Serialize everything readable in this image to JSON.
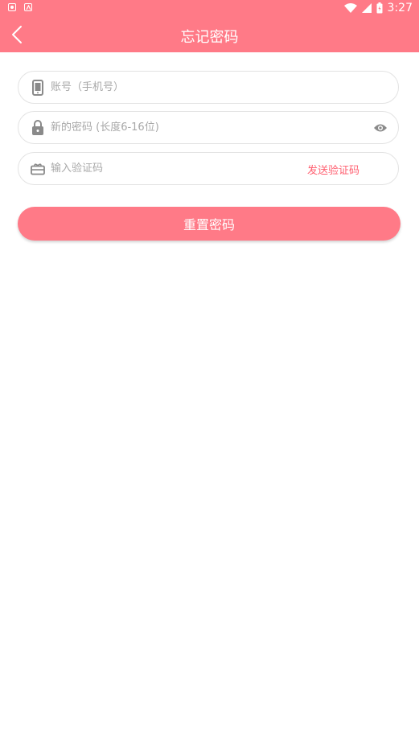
{
  "status_bar": {
    "time": "3:27",
    "left_icons": [
      "shield-icon",
      "a-icon"
    ],
    "right_icons": [
      "wifi-icon",
      "signal-icon",
      "battery-icon"
    ]
  },
  "app_bar": {
    "title": "忘记密码",
    "back_icon": "chevron-left-icon"
  },
  "form": {
    "account": {
      "value": "",
      "placeholder": "账号（手机号）",
      "icon": "phone-icon"
    },
    "password": {
      "value": "",
      "placeholder": "新的密码 (长度6-16位)",
      "icon": "lock-icon",
      "toggle_icon": "eye-icon"
    },
    "code": {
      "value": "",
      "placeholder": "输入验证码",
      "icon": "code-icon",
      "send_label": "发送验证码"
    },
    "submit_label": "重置密码"
  },
  "colors": {
    "primary": "#ff7a87",
    "accent_text": "#ff5f70",
    "border": "#e3e3e3",
    "placeholder": "#a8a8a8"
  }
}
